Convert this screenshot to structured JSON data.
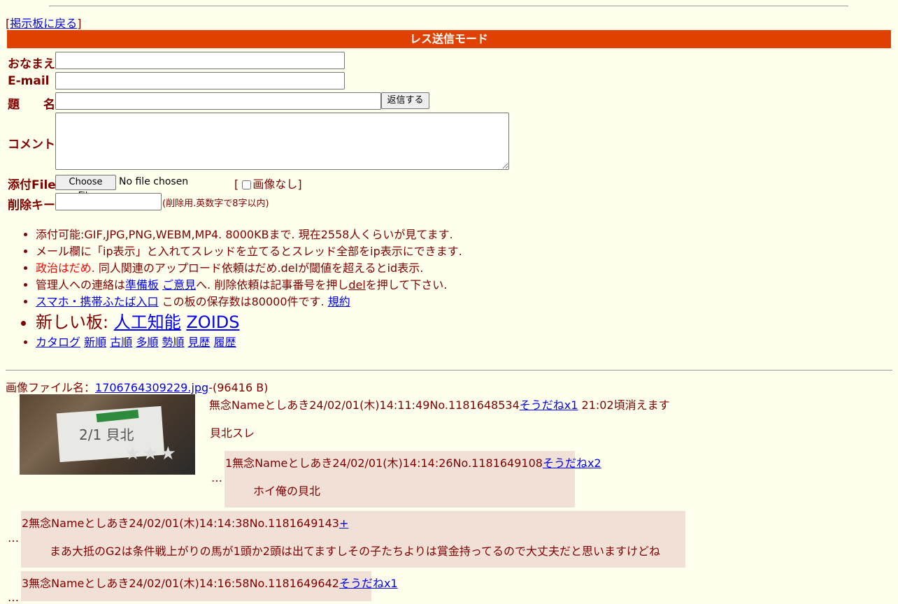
{
  "nav": {
    "back_bracket_open": "[",
    "back_label": "掲示板に戻る",
    "back_bracket_close": "]"
  },
  "form": {
    "banner": "レス送信モード",
    "name_label": "おなまえ",
    "email_label": "E-mail",
    "subject_label": "題　　名",
    "submit_label": "返信する",
    "comment_label": "コメント",
    "file_label": "添付File",
    "choose_file_label": "Choose File",
    "no_file_text": "No file chosen",
    "no_image_open": "[",
    "no_image_label": "画像なし",
    "no_image_close": "]",
    "delkey_label": "削除キー",
    "delkey_note": "(削除用.英数字で8字以内)"
  },
  "rules": {
    "line1": "添付可能:GIF,JPG,PNG,WEBM,MP4. 8000KBまで. 現在2558人くらいが見てます.",
    "line2": "メール欄に「ip表示」と入れてスレッドを立てるとスレッド全部をip表示にできます.",
    "line3_red": "政治はだめ.",
    "line3_rest": " 同人関連のアップロード依頼はだめ.delが閾値を超えるとid表示.",
    "line4_a": "管理人への連絡は",
    "line4_link1": "準備板",
    "line4_link2": "ご意見",
    "line4_b": "へ. 削除依頼は記事番号を押し",
    "line4_del": "del",
    "line4_c": "を押して下さい.",
    "line5_link": "スマホ・携帯ふたば入口",
    "line5_text": " この板の保存数は80000件です. ",
    "line5_terms": "規約",
    "new_boards_label": "新しい板: ",
    "new_board1": "人工知能",
    "new_board2": "ZOIDS",
    "sort_links": [
      "カタログ",
      "新順",
      "古順",
      "多順",
      "勢順",
      "見歴",
      "履歴"
    ]
  },
  "thread": {
    "file_prefix": "画像ファイル名：",
    "file_name": "1706764309229.jpg",
    "file_size": "-(96416 B)",
    "op_header": "無念Nameとしあき24/02/01(木)14:11:49No.1181648534",
    "op_sodane": "そうだねx1",
    "op_expire": " 21:02頃消えます",
    "op_body": "貝北スレ",
    "thumb_text": "2/1 貝北",
    "thumb_stars": "★★★",
    "replies": [
      {
        "header": "1無念Nameとしあき24/02/01(木)14:14:26No.1181649108",
        "sodane": "そうだねx2",
        "body": "ホイ俺の貝北"
      },
      {
        "header": "2無念Nameとしあき24/02/01(木)14:14:38No.1181649143",
        "sodane": "+",
        "body": "まあ大抵のG2は条件戦上がりの馬が1頭か2頭は出てますしその子たちよりは賞金持ってるので大丈夫だと思いますけどね"
      },
      {
        "header": "3無念Nameとしあき24/02/01(木)14:16:58No.1181649642",
        "sodane": "そうだねx1",
        "body": ""
      }
    ],
    "dots": "…"
  }
}
